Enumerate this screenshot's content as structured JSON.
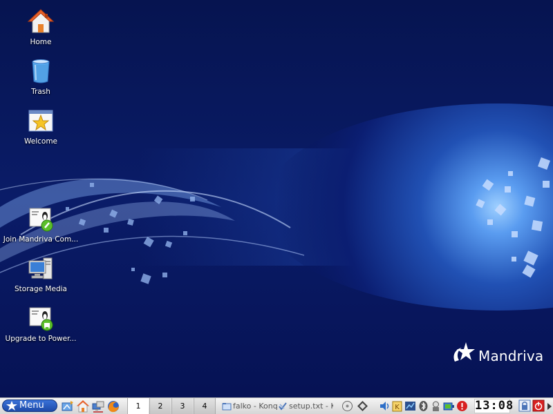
{
  "desktop": {
    "icons": [
      {
        "label": "Home",
        "icon": "home-icon"
      },
      {
        "label": "Trash",
        "icon": "trash-icon"
      },
      {
        "label": "Welcome",
        "icon": "welcome-icon"
      },
      {
        "label": "Join Mandriva Com...",
        "icon": "join-community-icon"
      },
      {
        "label": "Storage Media",
        "icon": "storage-media-icon"
      },
      {
        "label": "Upgrade to Power...",
        "icon": "upgrade-icon"
      }
    ],
    "brand": "Mandriva",
    "colors": {
      "background": "#06145a",
      "glow": "#5a9cf0"
    }
  },
  "taskbar": {
    "menu_label": "Menu",
    "launchers": [
      "desktop-icon",
      "home-icon",
      "network-icon",
      "firefox-icon"
    ],
    "pager": [
      "1",
      "2",
      "3",
      "4"
    ],
    "active_desktop": "1",
    "tasks": [
      {
        "label": "falko - Konq",
        "icon": "konqueror-icon"
      },
      {
        "label": "setup.txt - K",
        "icon": "text-editor-icon"
      }
    ],
    "tray_icons": [
      "disk-icon",
      "updates-icon",
      "volume-icon",
      "klipper-icon",
      "network-monitor-icon",
      "bluetooth-icon",
      "keyboard-icon",
      "battery-icon",
      "alert-icon"
    ],
    "clock": "13:08",
    "session_icons": [
      "lock-icon",
      "logout-icon"
    ]
  }
}
